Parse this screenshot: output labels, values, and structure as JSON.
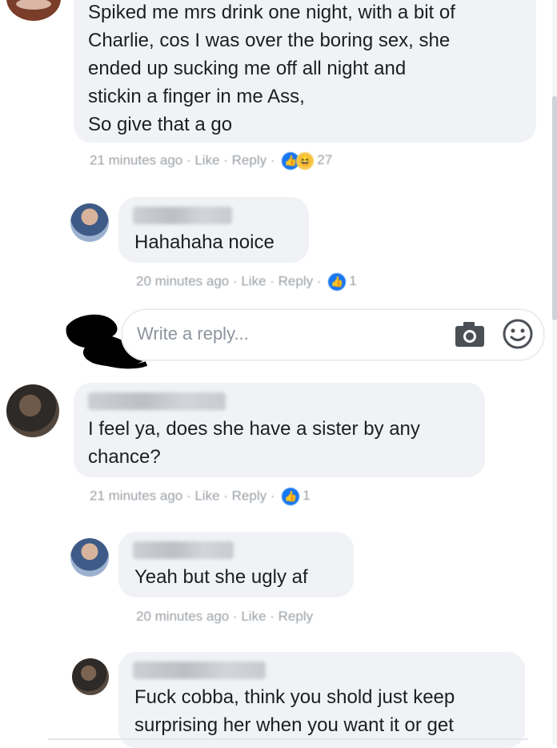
{
  "comments": [
    {
      "text": "Spiked me mrs drink one night, with a bit of\nCharlie, cos I was over the boring sex, she\nended up sucking me off all night and\nstickin a finger in me Ass,\nSo give that a go",
      "meta": "21 minutes ago · Like · Reply ·",
      "reactions": [
        "like",
        "haha"
      ],
      "reaction_count": "27"
    },
    {
      "text": "Hahahaha noice",
      "meta": "20 minutes ago · Like · Reply ·",
      "reactions": [
        "like"
      ],
      "reaction_count": "1"
    },
    {
      "text": "I feel ya, does she have a sister by any\nchance?",
      "meta": "21 minutes ago · Like · Reply ·",
      "reactions": [
        "like"
      ],
      "reaction_count": "1"
    },
    {
      "text": "Yeah but she ugly af",
      "meta": "20 minutes ago · Like · Reply"
    },
    {
      "text": "Fuck cobba, think you shold just keep\nsurprising her when you want it or get"
    }
  ],
  "reply_input": {
    "placeholder": "Write a reply..."
  },
  "icons": {
    "camera": "camera-icon",
    "emoji": "smiley-icon",
    "like": "thumbs-up-icon",
    "haha": "laughing-emoji-icon"
  },
  "colors": {
    "bubble": "#f0f2f5",
    "like_blue": "#1877f2",
    "meta_gray": "#9aa0a6"
  }
}
